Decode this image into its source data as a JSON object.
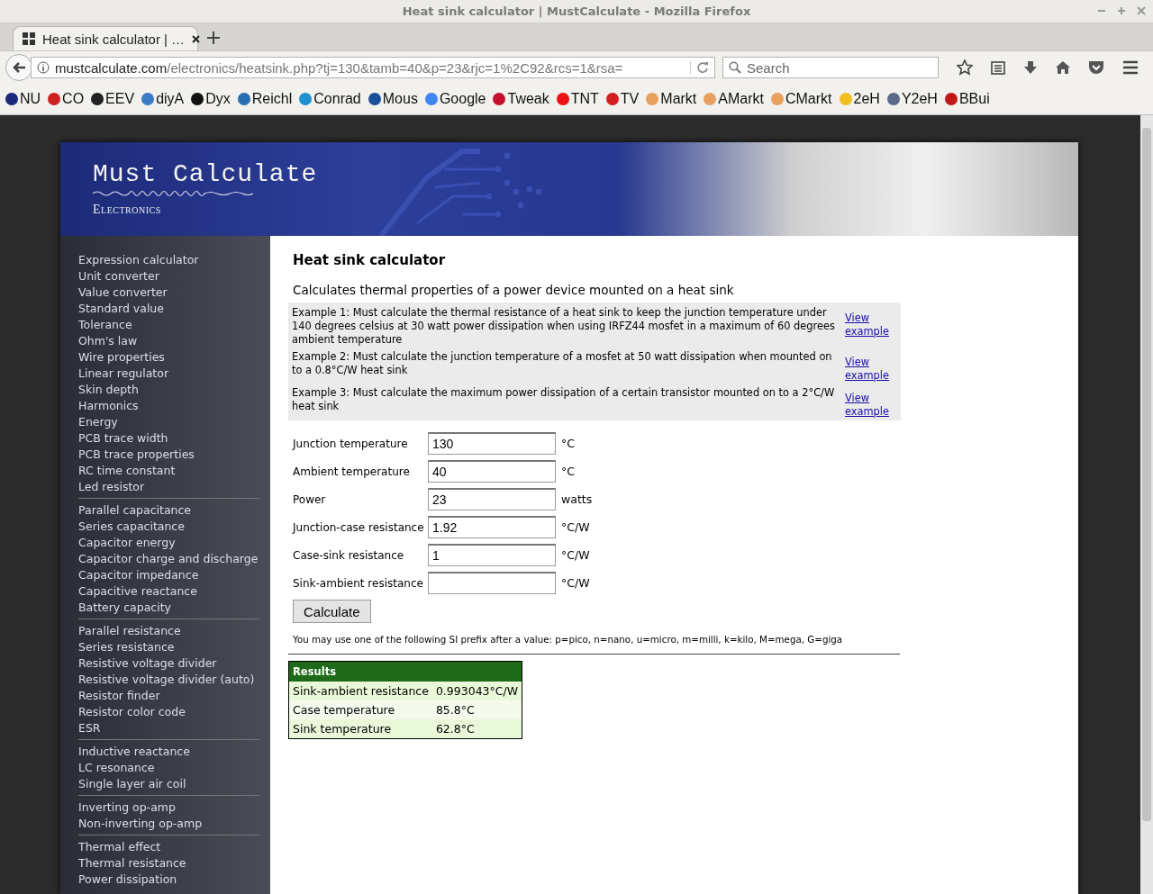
{
  "window": {
    "title": "Heat sink calculator | MustCalculate - Mozilla Firefox"
  },
  "tabs": [
    {
      "label": "Heat sink calculator | …",
      "selected": true
    }
  ],
  "address_bar": {
    "domain": "mustcalculate.com",
    "path": "/electronics/heatsink.php?tj=130&tamb=40&p=23&rjc=1%2C92&rcs=1&rsa="
  },
  "search": {
    "placeholder": "Search"
  },
  "bookmarks": [
    {
      "label": "NU",
      "color": "#1b2a7a"
    },
    {
      "label": "CO",
      "color": "#cc2222"
    },
    {
      "label": "EEV",
      "color": "#222222"
    },
    {
      "label": "diyA",
      "color": "#3a7bc8"
    },
    {
      "label": "Dyx",
      "color": "#111111"
    },
    {
      "label": "Reichl",
      "color": "#2a6fb0"
    },
    {
      "label": "Conrad",
      "color": "#1e90d0"
    },
    {
      "label": "Mous",
      "color": "#1b4f9a"
    },
    {
      "label": "Google",
      "color": "#4285f4"
    },
    {
      "label": "Tweak",
      "color": "#c8102e"
    },
    {
      "label": "TNT",
      "color": "#ee1111"
    },
    {
      "label": "TV",
      "color": "#d02020"
    },
    {
      "label": "Markt",
      "color": "#e8a060"
    },
    {
      "label": "AMarkt",
      "color": "#e8a060"
    },
    {
      "label": "CMarkt",
      "color": "#e8a060"
    },
    {
      "label": "2eH",
      "color": "#f0c020"
    },
    {
      "label": "Y2eH",
      "color": "#5a6a8a"
    },
    {
      "label": "BBui",
      "color": "#c01818"
    }
  ],
  "site": {
    "title": "Must Calculate",
    "subtitle": "Electronics"
  },
  "sidebar": {
    "groups": [
      {
        "items": [
          "Expression calculator",
          "Unit converter",
          "Value converter",
          "Standard value",
          "Tolerance",
          "Ohm's law",
          "Wire properties",
          "Linear regulator",
          "Skin depth",
          "Harmonics",
          "Energy",
          "PCB trace width",
          "PCB trace properties",
          "RC time constant",
          "Led resistor"
        ]
      },
      {
        "items": [
          "Parallel capacitance",
          "Series capacitance",
          "Capacitor energy",
          "Capacitor charge and discharge",
          "Capacitor impedance",
          "Capacitive reactance",
          "Battery capacity"
        ]
      },
      {
        "items": [
          "Parallel resistance",
          "Series resistance",
          "Resistive voltage divider",
          "Resistive voltage divider (auto)",
          "Resistor finder",
          "Resistor color code",
          "ESR"
        ]
      },
      {
        "items": [
          "Inductive reactance",
          "LC resonance",
          "Single layer air coil"
        ]
      },
      {
        "items": [
          "Inverting op-amp",
          "Non-inverting op-amp"
        ]
      },
      {
        "items": [
          "Thermal effect",
          "Thermal resistance",
          "Power dissipation"
        ]
      }
    ]
  },
  "main": {
    "heading": "Heat sink calculator",
    "description": "Calculates thermal properties of a power device mounted on a heat sink",
    "examples": [
      {
        "text": "Example 1: Must calculate the thermal resistance of a heat sink to keep the junction temperature under 140 degrees celsius at 30 watt power dissipation when using IRFZ44 mosfet in a maximum of 60 degrees ambient temperature",
        "link": "View example"
      },
      {
        "text": "Example 2: Must calculate the junction temperature of a mosfet at 50 watt dissipation when mounted on to a 0.8°C/W heat sink",
        "link": "View example"
      },
      {
        "text": "Example 3: Must calculate the maximum power dissipation of a certain transistor mounted on to a 2°C/W heat sink",
        "link": "View example"
      }
    ],
    "fields": [
      {
        "label": "Junction temperature",
        "value": "130",
        "unit": "°C"
      },
      {
        "label": "Ambient temperature",
        "value": "40",
        "unit": "°C"
      },
      {
        "label": "Power",
        "value": "23",
        "unit": "watts"
      },
      {
        "label": "Junction-case resistance",
        "value": "1.92",
        "unit": "°C/W"
      },
      {
        "label": "Case-sink resistance",
        "value": "1",
        "unit": "°C/W"
      },
      {
        "label": "Sink-ambient resistance",
        "unit": "°C/W"
      }
    ],
    "button": "Calculate",
    "note": "You may use one of the following SI prefix after a value: p=pico, n=nano, u=micro, m=milli, k=kilo, M=mega, G=giga",
    "results": {
      "title": "Results",
      "rows": [
        {
          "label": "Sink-ambient resistance",
          "value": "0.993043°C/W"
        },
        {
          "label": "Case temperature",
          "value": "85.8°C"
        },
        {
          "label": "Sink temperature",
          "value": "62.8°C"
        }
      ]
    }
  }
}
